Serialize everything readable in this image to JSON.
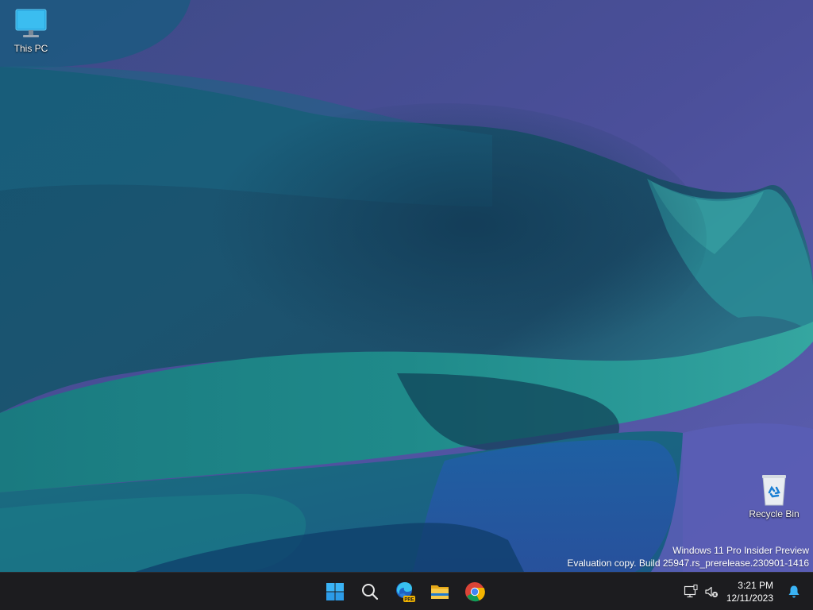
{
  "desktop": {
    "icons": [
      {
        "label": "This PC",
        "icon": "monitor-icon"
      },
      {
        "label": "Recycle Bin",
        "icon": "recycle-bin-icon"
      }
    ]
  },
  "watermark": {
    "line1": "Windows 11 Pro Insider Preview",
    "line2": "Evaluation copy. Build 25947.rs_prerelease.230901-1416"
  },
  "taskbar": {
    "apps": [
      {
        "name": "Start",
        "icon": "windows-logo-icon"
      },
      {
        "name": "Search",
        "icon": "search-icon"
      },
      {
        "name": "Microsoft Edge Canary",
        "icon": "edge-icon",
        "badge": "PRE"
      },
      {
        "name": "File Explorer",
        "icon": "folder-icon"
      },
      {
        "name": "Google Chrome",
        "icon": "chrome-icon"
      }
    ]
  },
  "tray": {
    "network_icon": "network-icon",
    "volume_icon": "volume-muted-icon",
    "time": "3:21 PM",
    "date": "12/11/2023",
    "notification_icon": "bell-icon"
  },
  "colors": {
    "accent": "#0078d4",
    "taskbar_bg": "#1c1c1f"
  }
}
